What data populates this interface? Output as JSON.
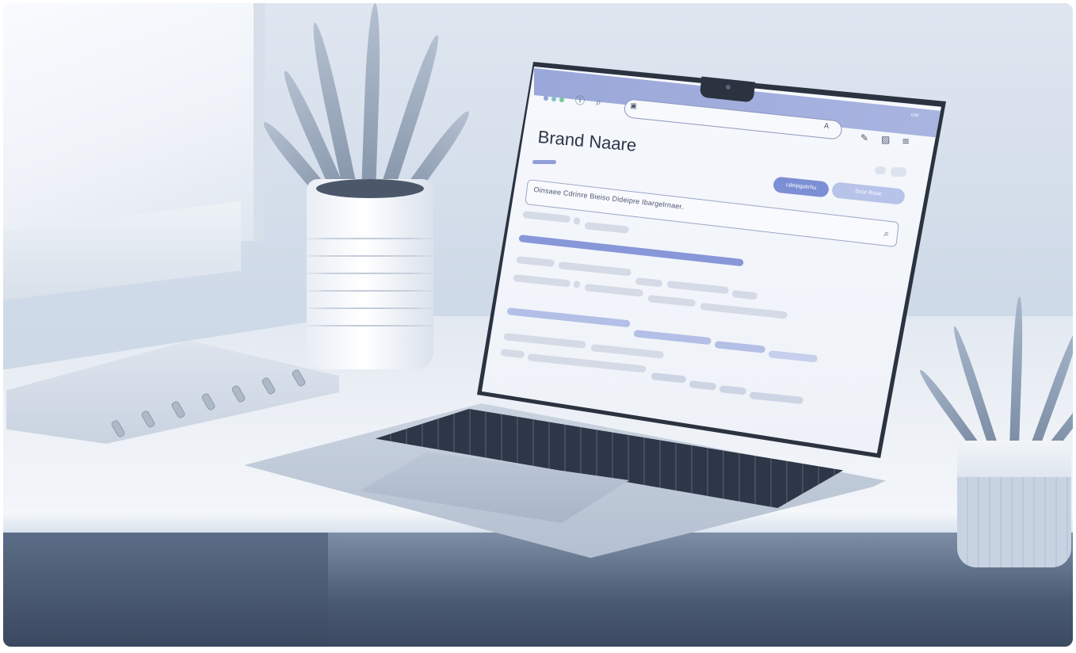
{
  "browser": {
    "brand_title": "Brand Naare",
    "search_placeholder": "Oinsaee Cdrinre Bieiso Dideipre Ibargelrnaer.",
    "primary_button_label": "cdeipgukrhu",
    "secondary_button_label": "Dcor Rooe",
    "corner_label": "cor",
    "window_dots": [
      "#8fa3d6",
      "#7fc2c8",
      "#79c79a"
    ],
    "accent_color": "#7d8fd4"
  },
  "icons": [
    "info-icon",
    "search-icon",
    "lock-icon",
    "font-icon",
    "edit-icon",
    "image-icon",
    "menu-icon"
  ]
}
